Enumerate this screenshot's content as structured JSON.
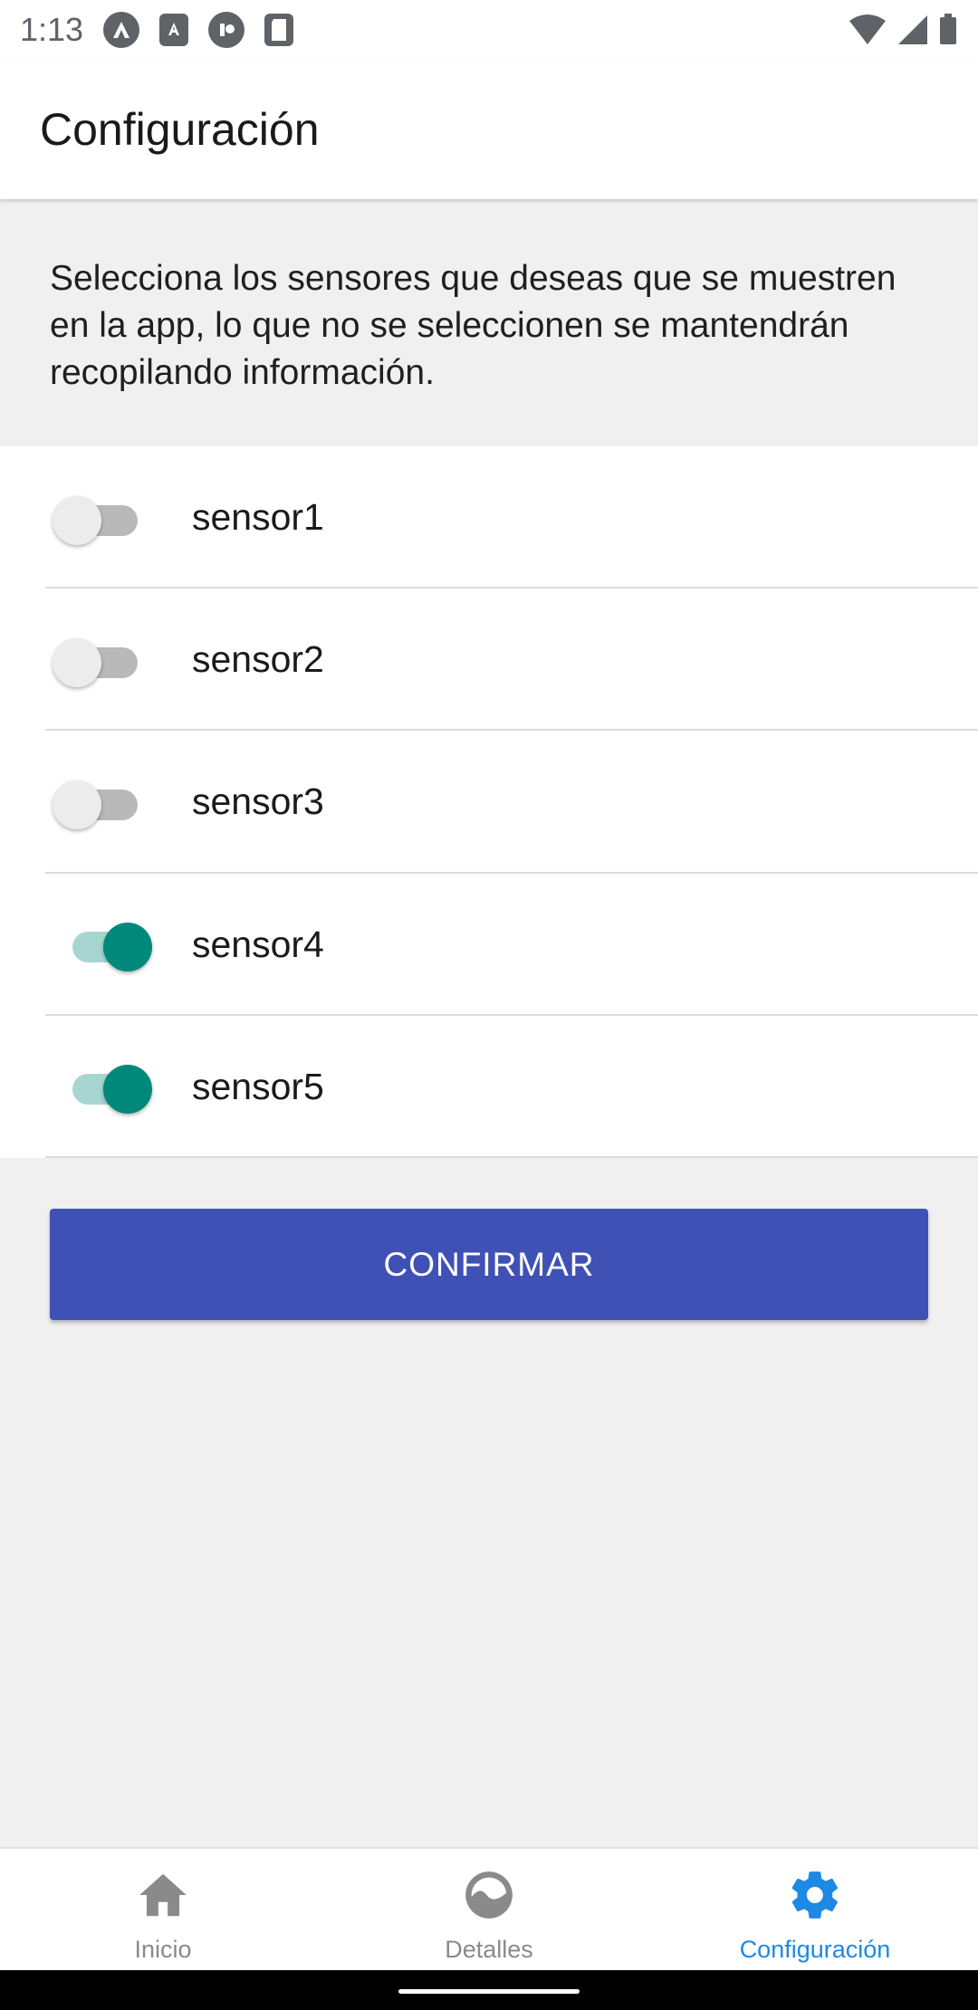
{
  "status_bar": {
    "time": "1:13"
  },
  "app_bar": {
    "title": "Configuración"
  },
  "description": "Selecciona los sensores que deseas que se muestren en la app, lo que no se seleccionen se mantendrán recopilando información.",
  "sensors": [
    {
      "label": "sensor1",
      "enabled": false
    },
    {
      "label": "sensor2",
      "enabled": false
    },
    {
      "label": "sensor3",
      "enabled": false
    },
    {
      "label": "sensor4",
      "enabled": true
    },
    {
      "label": "sensor5",
      "enabled": true
    }
  ],
  "confirm_button": {
    "label": "CONFIRMAR",
    "color": "#3f51b5"
  },
  "bottom_nav": {
    "items": [
      {
        "label": "Inicio",
        "icon": "home-icon",
        "active": false
      },
      {
        "label": "Detalles",
        "icon": "chart-circle-icon",
        "active": false
      },
      {
        "label": "Configuración",
        "icon": "gear-icon",
        "active": true
      }
    ],
    "active_color": "#1e88e5",
    "inactive_color": "#8a8a8a"
  },
  "colors": {
    "switch_on": "#00897b",
    "switch_on_track": "#a7d6d1"
  }
}
